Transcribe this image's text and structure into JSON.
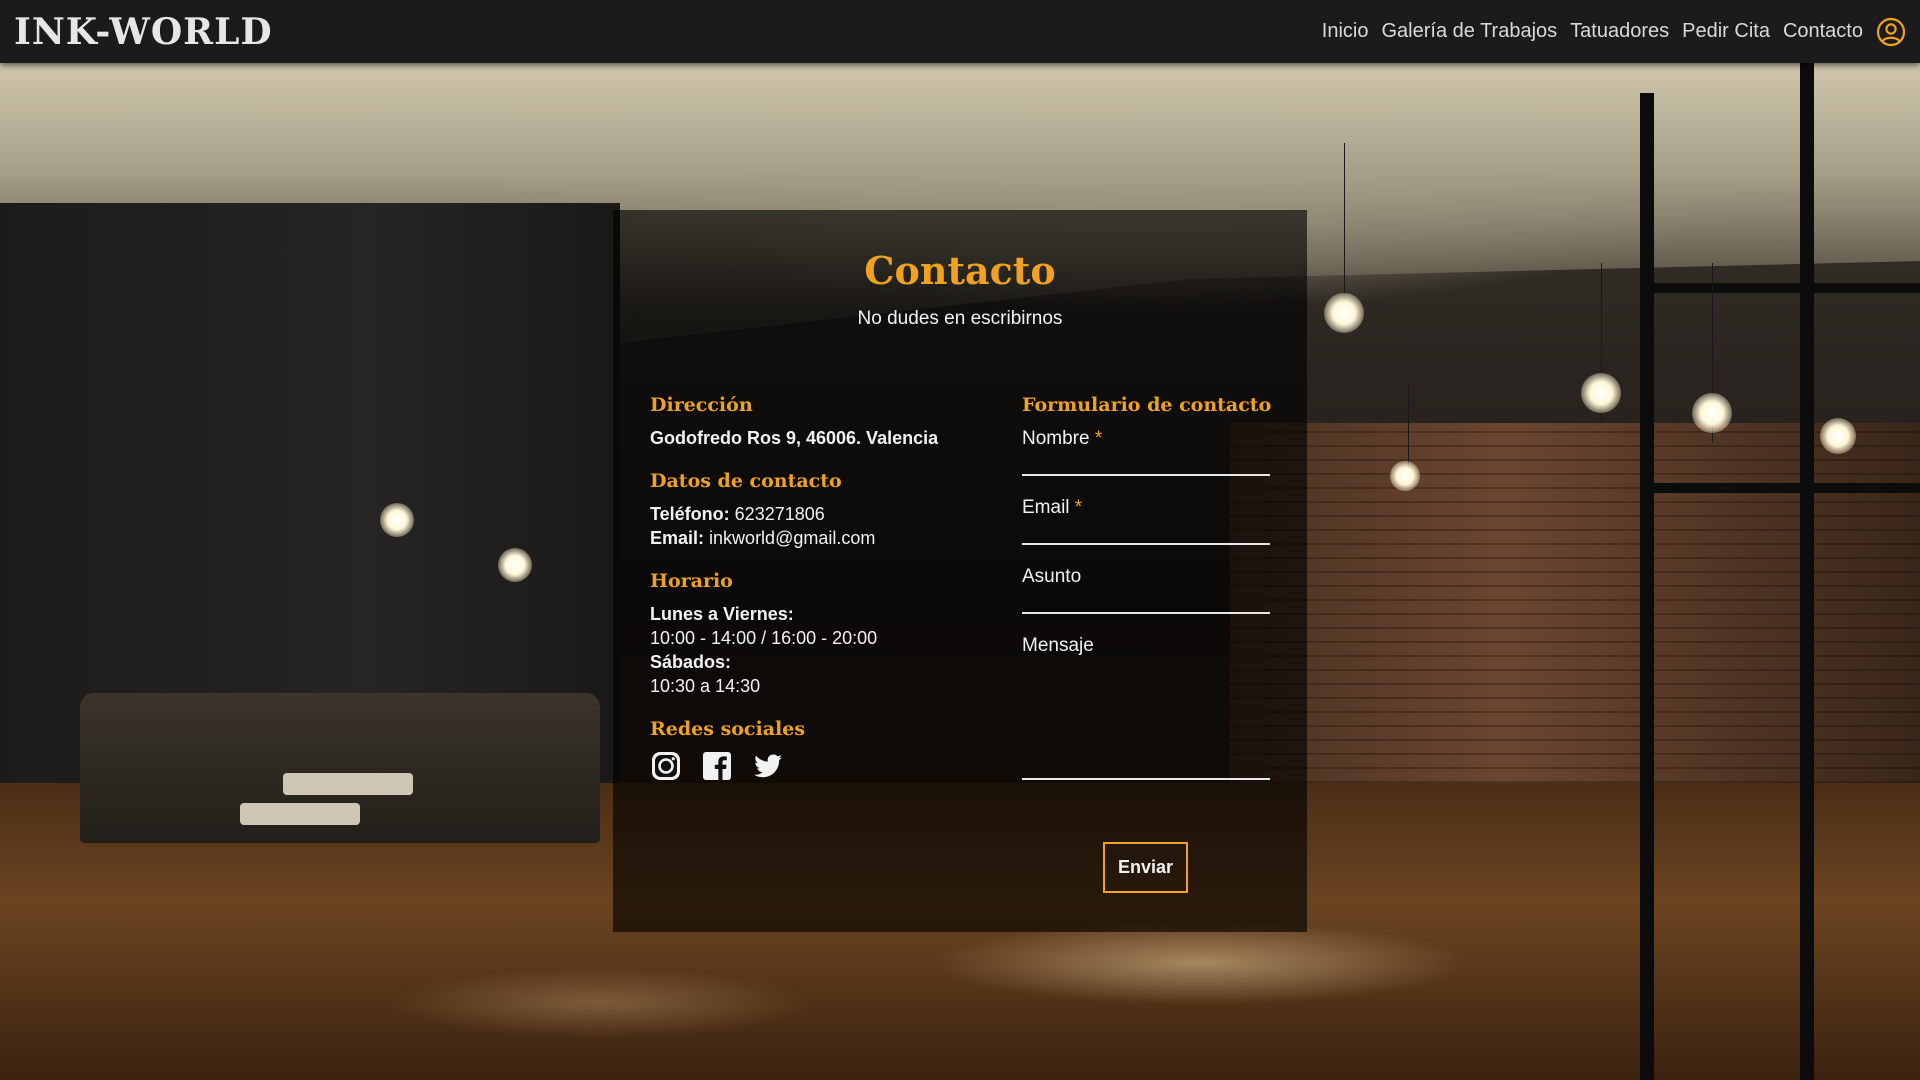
{
  "header": {
    "logo": "INK-WORLD",
    "nav": [
      {
        "label": "Inicio"
      },
      {
        "label": "Galería de Trabajos"
      },
      {
        "label": "Tatuadores"
      },
      {
        "label": "Pedir Cita"
      },
      {
        "label": "Contacto"
      }
    ],
    "user_icon": "user-circle-icon"
  },
  "contact": {
    "title": "Contacto",
    "subtitle": "No dudes en escribirnos",
    "address": {
      "title": "Dirección",
      "text": "Godofredo Ros 9, 46006. Valencia"
    },
    "contact_data": {
      "title": "Datos de contacto",
      "phone_label": "Teléfono:",
      "phone": "623271806",
      "email_label": "Email:",
      "email": "inkworld@gmail.com"
    },
    "schedule": {
      "title": "Horario",
      "weekdays_label": "Lunes a Viernes:",
      "weekdays_hours": "10:00 - 14:00 / 16:00 - 20:00",
      "saturday_label": "Sábados:",
      "saturday_hours": "10:30 a 14:30"
    },
    "social": {
      "title": "Redes sociales",
      "icons": [
        "instagram-icon",
        "facebook-icon",
        "twitter-icon"
      ]
    },
    "form": {
      "title": "Formulario de contacto",
      "name_label": "Nombre",
      "email_label": "Email",
      "subject_label": "Asunto",
      "message_label": "Mensaje",
      "required_mark": "*",
      "submit_label": "Enviar"
    }
  },
  "colors": {
    "accent": "#f0a11f",
    "header_bg": "#1b1b1b",
    "panel_bg": "rgba(0,0,0,0.62)"
  }
}
